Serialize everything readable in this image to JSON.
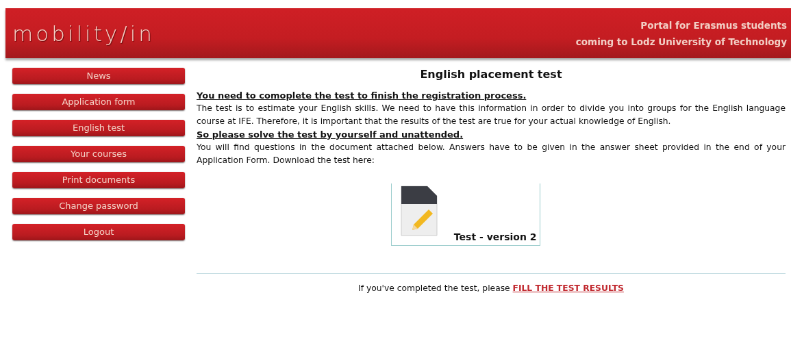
{
  "header": {
    "logo": "mobility/in",
    "tagline": [
      "Portal for Erasmus students",
      "coming to Lodz University of Technology"
    ]
  },
  "nav": {
    "items": [
      {
        "label": "News"
      },
      {
        "label": "Application form"
      },
      {
        "label": "English test"
      },
      {
        "label": "Your courses"
      },
      {
        "label": "Print documents"
      },
      {
        "label": "Change password"
      },
      {
        "label": "Logout"
      }
    ]
  },
  "content": {
    "title": "English placement test",
    "blocks": [
      {
        "kind": "heading",
        "text": "You need to comoplete the test to finish the registration process."
      },
      {
        "kind": "text",
        "text": "The test is to estimate your English skills. We need to have this information in order to divide you into groups for the English language course at IFE. Therefore, it is important that the results of the test are true for your actual knowledge of English."
      },
      {
        "kind": "heading",
        "text": "So please solve the test by yourself and unattended."
      },
      {
        "kind": "text",
        "text": "You will find questions in the document attached below. Answers have to be given in the answer sheet provided in the end of your Application Form. Download the test here:"
      }
    ],
    "download": {
      "label": "Test - version 2"
    },
    "footer": {
      "text": "If you've completed the test, please",
      "link": "FILL THE TEST RESULTS"
    }
  }
}
